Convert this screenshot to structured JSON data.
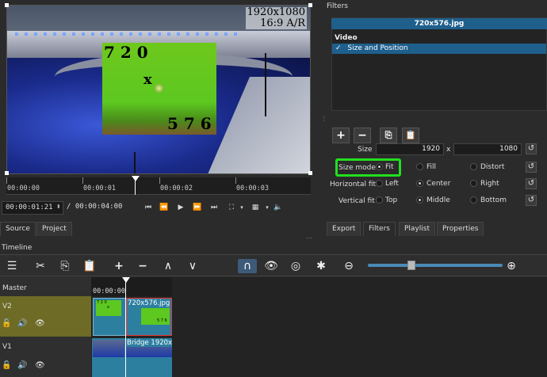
{
  "preview": {
    "resolution_line1": "1920x1080",
    "resolution_line2": "16:9 A/R",
    "overlay_num_top": "7 2 0",
    "overlay_x": "x",
    "overlay_num_bottom": "5 7 6"
  },
  "ruler": {
    "ticks": [
      "00:00:00",
      "00:00:01",
      "00:00:02",
      "00:00:03"
    ]
  },
  "transport": {
    "timecode": "00:00:01:21",
    "duration": "/ 00:00:04:00"
  },
  "left_tabs": {
    "source": "Source",
    "project": "Project"
  },
  "filters": {
    "title": "Filters",
    "clip_name": "720x576.jpg",
    "category": "Video",
    "filter_item": "Size and Position",
    "check": "✓",
    "size_label": "Size",
    "size_w": "1920",
    "size_x": "x",
    "size_h": "1080",
    "size_mode_label": "Size mode",
    "size_mode_options": [
      "Fit",
      "Fill",
      "Distort"
    ],
    "hfit_label": "Horizontal fit",
    "hfit_options": [
      "Left",
      "Center",
      "Right"
    ],
    "vfit_label": "Vertical fit",
    "vfit_options": [
      "Top",
      "Middle",
      "Bottom"
    ]
  },
  "right_tabs": {
    "export": "Export",
    "filters": "Filters",
    "playlist": "Playlist",
    "properties": "Properties"
  },
  "timeline": {
    "label": "Timeline",
    "ruler_time": "00:00:00",
    "master": "Master",
    "v2": "V2",
    "v1": "V1",
    "clip_v2_name": "720x576.jpg",
    "clip_v1_name": "Bridge 1920x1",
    "thumb_nums_top": "7 2 0",
    "thumb_x": "x",
    "thumb_nums_bottom": "5 7 6"
  }
}
